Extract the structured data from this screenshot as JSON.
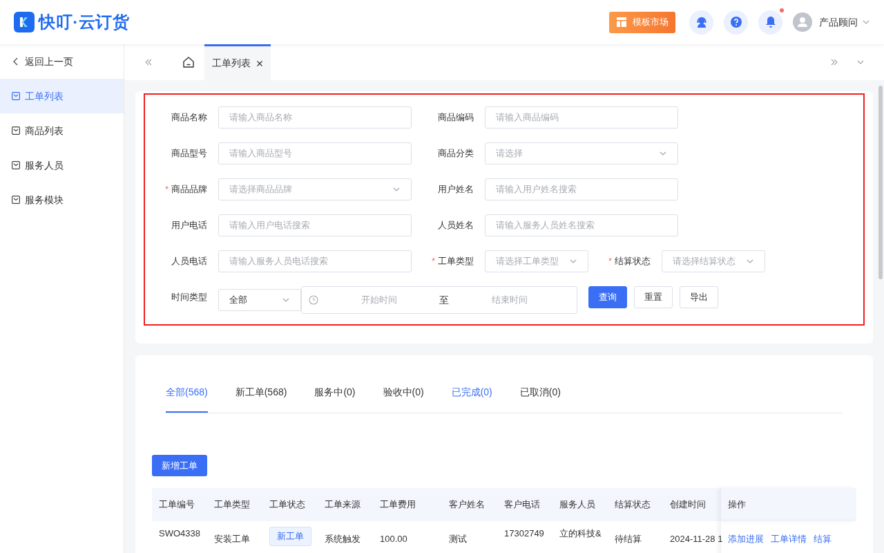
{
  "brand": {
    "name": "快叮·云订货"
  },
  "header": {
    "market_button": "模板市场",
    "notification_badge": true,
    "user": "产品顾问"
  },
  "sidebar": {
    "back": "返回上一页",
    "items": [
      {
        "label": "工单列表",
        "selected": true
      },
      {
        "label": "商品列表",
        "selected": false
      },
      {
        "label": "服务人员",
        "selected": false
      },
      {
        "label": "服务模块",
        "selected": false
      }
    ]
  },
  "page_tabs": [
    {
      "label": "工单列表",
      "selected": true
    }
  ],
  "filters": [
    {
      "kind": "input",
      "label": "商品名称",
      "placeholder": "请输入商品名称"
    },
    {
      "kind": "input",
      "label": "商品编码",
      "placeholder": "请输入商品编码"
    },
    {
      "kind": "input",
      "label": "商品型号",
      "placeholder": "请输入商品型号"
    },
    {
      "kind": "select",
      "label": "商品分类",
      "placeholder": "请选择"
    },
    {
      "kind": "select",
      "label": "商品品牌",
      "placeholder": "请选择商品品牌",
      "required_mark": "*"
    },
    {
      "kind": "input",
      "label": "用户姓名",
      "placeholder": "请输入用户姓名搜索"
    },
    {
      "kind": "input",
      "label": "用户电话",
      "placeholder": "请输入用户电话搜索"
    },
    {
      "kind": "input",
      "label": "人员姓名",
      "placeholder": "请输入服务人员姓名搜索"
    },
    {
      "kind": "input",
      "label": "人员电话",
      "placeholder": "请输入服务人员电话搜索"
    },
    {
      "kind": "select",
      "label": "工单类型",
      "placeholder": "请选择工单类型",
      "required_mark": "*"
    },
    {
      "kind": "select",
      "label": "结算状态",
      "placeholder": "请选择结算状态",
      "required_mark": "*"
    }
  ],
  "time_filter": {
    "label": "时间类型",
    "value": "全部",
    "start_placeholder": "开始时间",
    "separator": "至",
    "end_placeholder": "结束时间"
  },
  "actions": [
    {
      "label": "查询",
      "kind": "primary"
    },
    {
      "label": "重置",
      "kind": "default"
    },
    {
      "label": "导出",
      "kind": "default"
    }
  ],
  "status_tabs": [
    {
      "label": "全部(568)",
      "selected": true,
      "hovered": false
    },
    {
      "label": "新工单(568)",
      "selected": false,
      "hovered": false
    },
    {
      "label": "服务中(0)",
      "selected": false,
      "hovered": false
    },
    {
      "label": "验收中(0)",
      "selected": false,
      "hovered": false
    },
    {
      "label": "已完成(0)",
      "selected": false,
      "hovered": true
    },
    {
      "label": "已取消(0)",
      "selected": false,
      "hovered": false
    }
  ],
  "add_button": "新增工单",
  "table": {
    "columns": [
      "工单编号",
      "工单类型",
      "工单状态",
      "工单来源",
      "工单费用",
      "客户姓名",
      "客户电话",
      "服务人员",
      "结算状态",
      "创建时间",
      "操作"
    ],
    "rows": [
      {
        "cells": [
          "SWO4338",
          "安装工单",
          "新工单",
          "系统触发",
          "100.00",
          "测试",
          "17302749",
          "立的科技&",
          "待结算",
          "2024-11-28 1"
        ],
        "actions": [
          "添加进展",
          "工单详情",
          "结算"
        ]
      }
    ]
  }
}
